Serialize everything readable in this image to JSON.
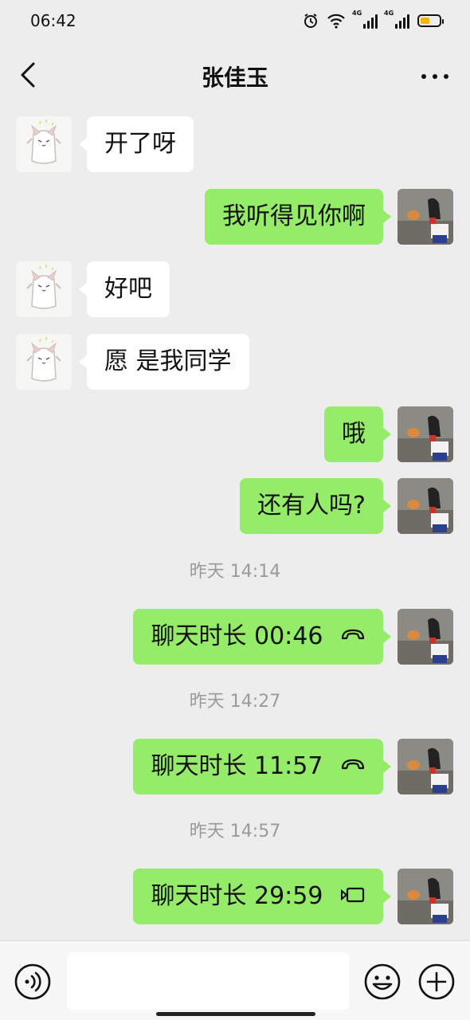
{
  "status_bar": {
    "time": "06:42",
    "network_1": "4G",
    "network_2": "4G",
    "battery_color": "#f2b705"
  },
  "header": {
    "title": "张佳玉",
    "back_icon": "chevron-left-icon",
    "more_icon": "more-dots-icon"
  },
  "messages": [
    {
      "direction": "in",
      "text": "开了呀"
    },
    {
      "direction": "out",
      "text": "我听得见你啊"
    },
    {
      "direction": "in",
      "text": "好吧"
    },
    {
      "direction": "in",
      "text": "愿 是我同学"
    },
    {
      "direction": "out",
      "text": "哦"
    },
    {
      "direction": "out",
      "text": "还有人吗?"
    },
    {
      "type": "timestamp",
      "text": "昨天 14:14"
    },
    {
      "direction": "out",
      "text": "聊天时长 00:46",
      "icon": "voice-call-icon"
    },
    {
      "type": "timestamp",
      "text": "昨天 14:27"
    },
    {
      "direction": "out",
      "text": "聊天时长 11:57",
      "icon": "voice-call-icon"
    },
    {
      "type": "timestamp",
      "text": "昨天 14:57"
    },
    {
      "direction": "out",
      "text": "聊天时长 29:59",
      "icon": "video-call-icon"
    }
  ],
  "bottom_bar": {
    "input_value": "",
    "voice_icon": "voice-mode-icon",
    "emoji_icon": "emoji-icon",
    "add_icon": "plus-circle-icon"
  },
  "colors": {
    "outgoing_bubble": "#95ec69",
    "incoming_bubble": "#ffffff",
    "background": "#ededed"
  }
}
